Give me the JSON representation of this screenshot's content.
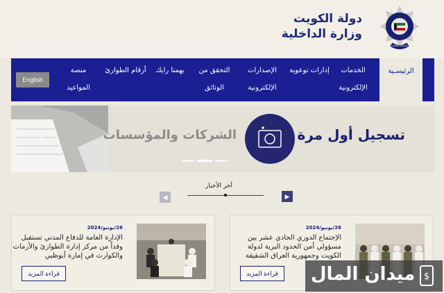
{
  "header": {
    "org_line1": "دولة الكويت",
    "org_line2": "وزارة الداخلية",
    "logo_text": "KUWAIT POLICE"
  },
  "nav": {
    "home": "الرئيسـية",
    "services": [
      "الخدمات",
      "الإلكترونية"
    ],
    "awareness": "إدارات توعوية",
    "publications": [
      "الإصدارات",
      "الإلكترونية"
    ],
    "verify": [
      "التحقق من",
      "الوثائق"
    ],
    "feedback": "يهمنا رايك",
    "emergency": "أرقام الطوارئ",
    "appointments": [
      "منصة",
      "المواعيد"
    ],
    "language": "English"
  },
  "banner": {
    "title": "تسجيل أول مرة",
    "subtitle": "الشركات والمؤسسات"
  },
  "news": {
    "heading": "آخر الأخبار",
    "items": [
      {
        "date": "26/يونيو/2024",
        "text": "الإدارة العامة للدفاع المدني تستقبل وفداً من مركز إدارة الطوارئ والأزمات والكوارث في إمارة أبوظبي",
        "button": "قراءة المزيد"
      },
      {
        "date": "26/يونيو/2024",
        "text": "الإجتماع الدوري الحادي عشر بين مسؤولي أمن الحدود البرية لدولة الكويت وجمهورية العراق الشقيقة",
        "button": "قراءة المزيد"
      }
    ]
  },
  "watermark": {
    "text": "ميدان المال"
  },
  "colors": {
    "nav_bg": "#1a1f93",
    "brand_dark": "#1a1f70",
    "page_bg": "#ece9e1"
  }
}
